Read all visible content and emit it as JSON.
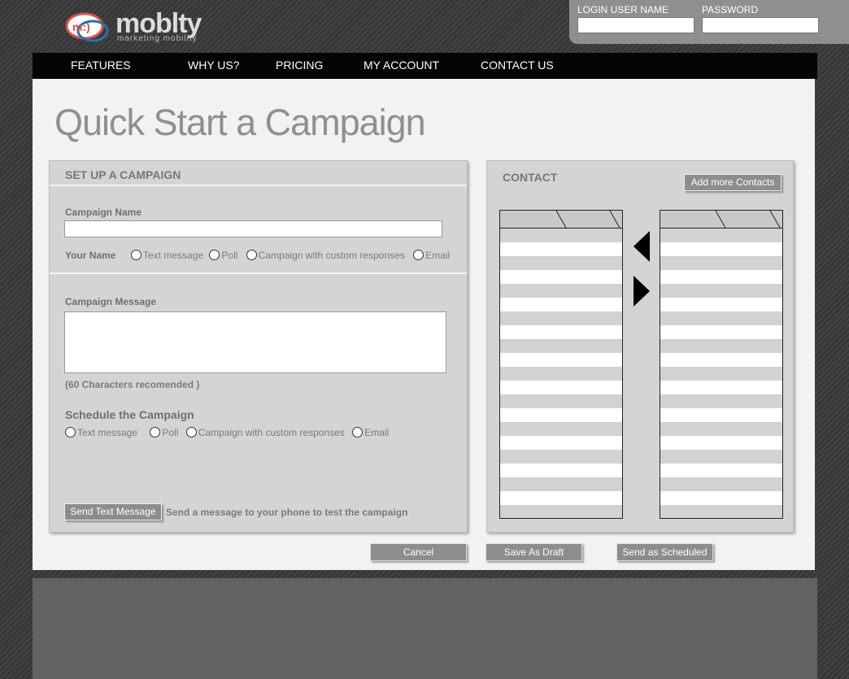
{
  "brand": {
    "name": "moblty",
    "tagline": "marketing mobility",
    "logo_mark": "m:)"
  },
  "login": {
    "username_label": "LOGIN USER NAME",
    "password_label": "PASSWORD",
    "username_value": "",
    "password_value": ""
  },
  "nav": {
    "items": [
      {
        "label": "FEATURES"
      },
      {
        "label": "WHY US?"
      },
      {
        "label": "PRICING"
      },
      {
        "label": "MY ACCOUNT"
      },
      {
        "label": "CONTACT US"
      }
    ]
  },
  "page": {
    "title": "Quick Start a Campaign"
  },
  "setup": {
    "heading": "SET UP A CAMPAIGN",
    "campaign_name_label": "Campaign Name",
    "campaign_name_value": "",
    "your_name_label": "Your Name",
    "type_options": [
      "Text message",
      "Poll",
      "Campaign with custom responses",
      "Email"
    ],
    "message_label": "Campaign Message",
    "message_value": "",
    "char_note": "(60 Characters recomended )",
    "schedule_label": "Schedule the Campaign",
    "schedule_options": [
      "Text message",
      "Poll",
      "Campaign with custom responses",
      "Email"
    ],
    "send_test_button": "Send Text Message",
    "send_test_note": "Send a message to your phone to test the campaign"
  },
  "contact": {
    "heading": "CONTACT",
    "add_button": "Add more Contacts"
  },
  "actions": {
    "cancel": "Cancel",
    "save_draft": "Save As Draft",
    "send_scheduled": "Send as Scheduled"
  },
  "colors": {
    "nav_bg": "#050505",
    "panel_bg": "#d4d4d4",
    "button_bg": "#8d8d8d",
    "title_gray": "#8f8f8f"
  },
  "icons": {
    "move_left": "arrow-left-icon",
    "move_right": "arrow-right-icon"
  }
}
